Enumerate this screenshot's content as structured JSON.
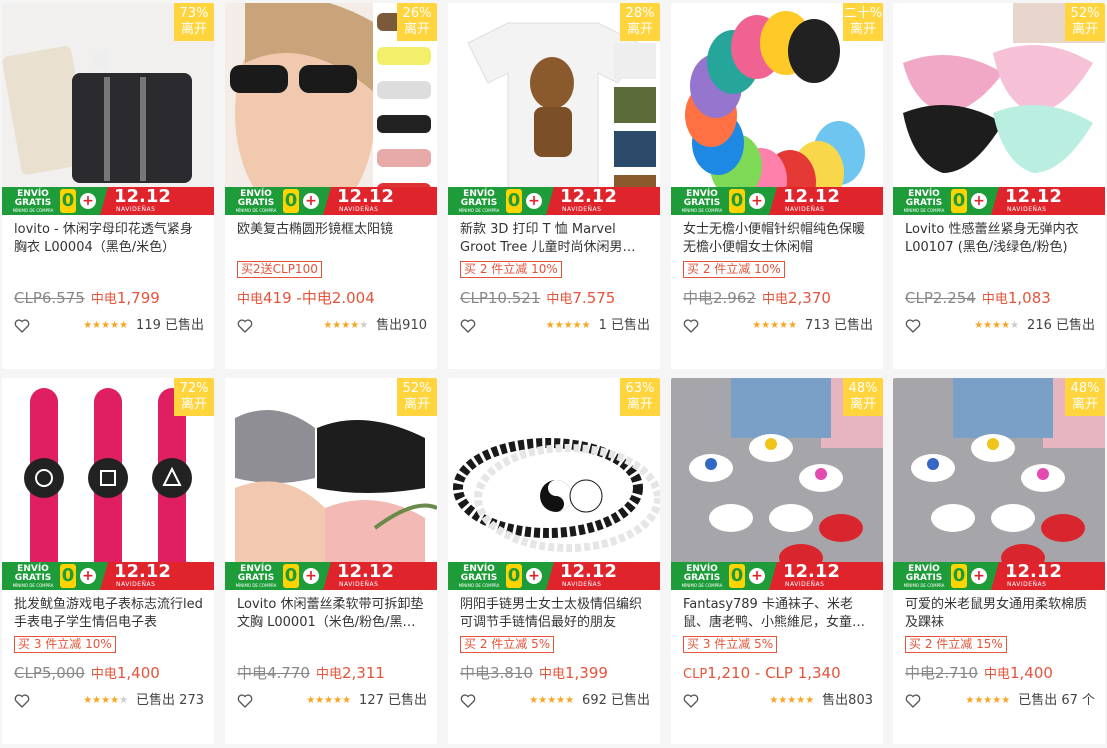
{
  "badge_suffix": "离开",
  "banner": {
    "envio": "ENVÍO GRATIS",
    "minimo": "MÍNIMO DE COMPRA",
    "zero": "0",
    "plus": "+",
    "date": "12.12",
    "nav": "NAVIDEÑAS"
  },
  "colors": {
    "accent": "#e4543b",
    "badge": "#ffd43c",
    "banner_green": "#1f9c3a",
    "banner_red": "#e0242c",
    "star": "#f6a623"
  },
  "products": [
    {
      "badge": "73%",
      "title": "lovito - 休闲字母印花透气紧身胸衣 L00004（黑色/米色）",
      "promo": "",
      "old_price": "CLP6.575",
      "cur": "中电",
      "price": "1,799",
      "stars": "★★★★★",
      "stars_off": "",
      "sold": "119 已售出",
      "image": "corset"
    },
    {
      "badge": "26%",
      "title": "欧美复古椭圆形镜框太阳镜",
      "promo": "买2送CLP100",
      "old_price": "",
      "cur": "中电",
      "price": "419 -中电2.004",
      "stars": "★★★★",
      "stars_off": "★",
      "sold": "售出910",
      "image": "sunglasses"
    },
    {
      "badge": "28%",
      "title": "新款 3D 打印 T 恤 Marvel Groot Tree 儿童时尚休闲男…",
      "promo": "买 2 件立减 10%",
      "old_price": "CLP10.521",
      "cur": "中电",
      "price": "7.575",
      "stars": "★★★★★",
      "stars_off": "",
      "sold": "1 已售出",
      "image": "tshirt"
    },
    {
      "badge": "二十%",
      "title": "女士无檐小便帽针织帽纯色保暖无檐小便帽女士休闲帽",
      "promo": "买 2 件立减 10%",
      "old_price": "中电2.962",
      "cur": "中电",
      "price": "2,370",
      "stars": "★★★★★",
      "stars_off": "",
      "sold": "713 已售出",
      "image": "beanies"
    },
    {
      "badge": "52%",
      "title": "Lovito 性感蕾丝紧身无弹内衣 L00107 (黑色/浅绿色/粉色)",
      "promo": "",
      "old_price": "CLP2.254",
      "cur": "中电",
      "price": "1,083",
      "stars": "★★★★",
      "stars_off": "★",
      "sold": "216 已售出",
      "image": "lingerie"
    },
    {
      "badge": "72%",
      "title": "批发鱿鱼游戏电子表标志流行led手表电子学生情侣电子表",
      "promo": "买 3 件立减 10%",
      "old_price": "CLP5,000",
      "cur": "中电",
      "price": "1,400",
      "stars": "★★★★",
      "stars_off": "★",
      "sold": "已售出 273",
      "image": "watches"
    },
    {
      "badge": "52%",
      "title": "Lovito 休闲蕾丝柔软带可拆卸垫文胸 L00001（米色/粉色/黑…",
      "promo": "",
      "old_price": "中电4.770",
      "cur": "中电",
      "price": "2,311",
      "stars": "★★★★★",
      "stars_off": "",
      "sold": "127 已售出",
      "image": "bras"
    },
    {
      "badge": "63%",
      "title": "阴阳手链男士女士太极情侣编织可调节手链情侣最好的朋友",
      "promo": "买 2 件立减 5%",
      "old_price": "中电3.810",
      "cur": "中电",
      "price": "1,399",
      "stars": "★★★★★",
      "stars_off": "",
      "sold": "692 已售出",
      "image": "bracelet"
    },
    {
      "badge": "48%",
      "title": "Fantasy789 卡通袜子、米老鼠、唐老鸭、小熊維尼，女童…",
      "promo": "买 3 件立减 5%",
      "old_price": "",
      "cur": "CLP",
      "price": "1,210 - CLP 1,340",
      "stars": "★★★★★",
      "stars_off": "",
      "sold": "售出803",
      "image": "socks"
    },
    {
      "badge": "48%",
      "title": "可爱的米老鼠男女通用柔软棉质及踝袜",
      "promo": "买 2 件立减 15%",
      "old_price": "中电2.710",
      "cur": "中电",
      "price": "1,400",
      "stars": "★★★★★",
      "stars_off": "",
      "sold": "已售出 67 个",
      "image": "socks2"
    }
  ]
}
